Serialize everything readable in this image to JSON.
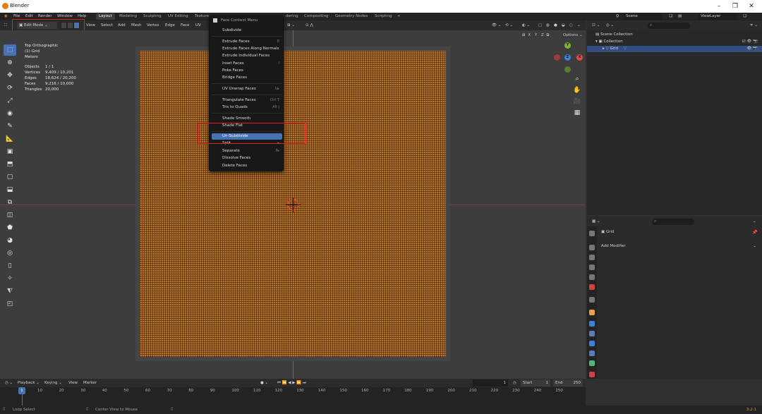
{
  "window": {
    "title": "Blender",
    "controls": [
      "–",
      "❐",
      "✕"
    ]
  },
  "topbar": {
    "menus": [
      "File",
      "Edit",
      "Render",
      "Window",
      "Help"
    ],
    "workspaces": [
      "Layout",
      "Modeling",
      "Sculpting",
      "UV Editing",
      "Texture",
      "dering",
      "Compositing",
      "Geometry Nodes",
      "Scripting",
      "+"
    ],
    "active_workspace": "Layout",
    "scene": "Scene",
    "view_layer": "ViewLayer"
  },
  "viewport_header": {
    "mode": "Edit Mode",
    "menus": [
      "View",
      "Select",
      "Add",
      "Mesh",
      "Vertex",
      "Edge",
      "Face",
      "UV"
    ],
    "options": "Options",
    "axes": [
      "X",
      "Y",
      "Z"
    ]
  },
  "overlay": {
    "view": "Top Orthographic",
    "object": "(1) Grid",
    "units": "Meters",
    "stats": [
      {
        "label": "Objects",
        "value": "1 / 1"
      },
      {
        "label": "Vertices",
        "value": "9,409 / 10,201"
      },
      {
        "label": "Edges",
        "value": "18,624 / 20,200"
      },
      {
        "label": "Faces",
        "value": "9,216 / 10,000"
      },
      {
        "label": "Triangles",
        "value": "20,000"
      }
    ]
  },
  "gizmo": {
    "x": "X",
    "y": "Y",
    "z": "Z"
  },
  "context_menu": {
    "title": "Face Context Menu",
    "items": [
      {
        "label": "Subdivide",
        "shortcut": ""
      },
      {
        "label": "Extrude Faces",
        "shortcut": "E"
      },
      {
        "label": "Extrude Faces Along Normals",
        "shortcut": ""
      },
      {
        "label": "Extrude Individual Faces",
        "shortcut": ""
      },
      {
        "label": "Inset Faces",
        "shortcut": "I"
      },
      {
        "label": "Poke Faces",
        "shortcut": ""
      },
      {
        "label": "Bridge Faces",
        "shortcut": ""
      },
      {
        "label": "UV Unwrap Faces",
        "shortcut": "U▸"
      },
      {
        "label": "Triangulate Faces",
        "shortcut": "Ctrl T"
      },
      {
        "label": "Tris to Quads",
        "shortcut": "Alt J"
      },
      {
        "label": "Shade Smooth",
        "shortcut": ""
      },
      {
        "label": "Shade Flat",
        "shortcut": ""
      },
      {
        "label": "Un-Subdivide",
        "shortcut": ""
      },
      {
        "label": "Split",
        "shortcut": "▸"
      },
      {
        "label": "Separate",
        "shortcut": "P▸"
      },
      {
        "label": "Dissolve Faces",
        "shortcut": ""
      },
      {
        "label": "Delete Faces",
        "shortcut": ""
      }
    ],
    "highlighted": "Un-Subdivide"
  },
  "outliner": {
    "collection_root": "Scene Collection",
    "collection": "Collection",
    "object": "Grid"
  },
  "properties": {
    "object": "Grid",
    "add_modifier": "Add Modifier"
  },
  "timeline": {
    "menus": [
      "Playback",
      "Keying",
      "View",
      "Marker"
    ],
    "current_frame": "1",
    "start_label": "Start",
    "start": "1",
    "end_label": "End",
    "end": "250",
    "ticks": [
      "1",
      "10",
      "20",
      "30",
      "40",
      "50",
      "60",
      "70",
      "80",
      "90",
      "100",
      "110",
      "120",
      "130",
      "140",
      "150",
      "160",
      "170",
      "180",
      "190",
      "200",
      "210",
      "220",
      "230",
      "240",
      "250"
    ]
  },
  "status_bar": {
    "left": "Loop Select",
    "middle": "Center View to Mouse",
    "version": "3.2.1"
  },
  "colors": {
    "accent": "#4772b3",
    "mesh": "#b5722c",
    "annotation": "#e0201b"
  }
}
